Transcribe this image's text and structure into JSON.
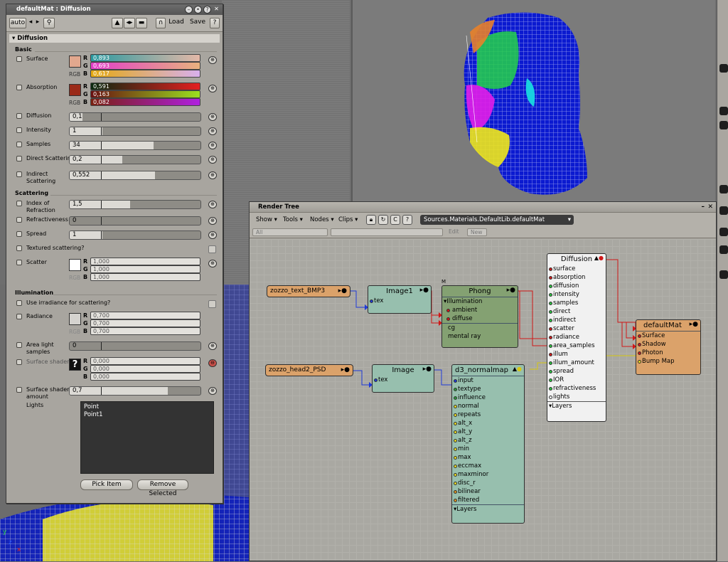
{
  "property_editor": {
    "title": "defaultMat : Diffusion",
    "toolbar": {
      "auto": "auto",
      "load": "Load",
      "save": "Save",
      "help": "?"
    },
    "section": "Diffusion",
    "groups": {
      "basic": "Basic",
      "scattering": "Scattering",
      "illumination": "Illumination"
    },
    "surface": {
      "label": "Surface",
      "color": "#e2a88e",
      "r": "0,893",
      "g": "0,693",
      "b": "0,617"
    },
    "absorption": {
      "label": "Absorption",
      "color": "#9b2a18",
      "r": "0,591",
      "g": "0,163",
      "b": "0,082"
    },
    "diffusion": {
      "label": "Diffusion",
      "value": "0,1",
      "fill": 0.1
    },
    "intensity": {
      "label": "Intensity",
      "value": "1",
      "fill": 0.25
    },
    "samples": {
      "label": "Samples",
      "value": "34",
      "fill": 0.64
    },
    "direct": {
      "label": "Direct Scattering",
      "value": "0,2",
      "fill": 0.4
    },
    "indirect": {
      "label": "Indirect Scattering",
      "value": "0,552",
      "fill": 0.65
    },
    "ior": {
      "label": "Index of Refraction",
      "value": "1,5",
      "fill": 0.46
    },
    "refractiveness": {
      "label": "Refractiveness",
      "value": "0",
      "fill": 0.0
    },
    "spread": {
      "label": "Spread",
      "value": "1",
      "fill": 0.25
    },
    "textured_scattering": {
      "label": "Textured scattering?"
    },
    "scatter": {
      "label": "Scatter",
      "color": "#ffffff",
      "r": "1,000",
      "g": "1,000",
      "b": "1,000"
    },
    "use_irradiance": {
      "label": "Use irradiance for scattering?"
    },
    "radiance": {
      "label": "Radiance",
      "color": "#d5d3cf",
      "r": "0,700",
      "g": "0,700",
      "b": "0,700"
    },
    "area_light": {
      "label": "Area light samples",
      "value": "0",
      "fill": 0.0
    },
    "surface_shader": {
      "label": "Surface shader",
      "r": "0,000",
      "g": "0,000",
      "b": "0,000"
    },
    "surface_shader_amount": {
      "label": "Surface shader amount",
      "value": "0,7",
      "fill": 0.75
    },
    "lights": {
      "label": "Lights",
      "items": [
        "Point",
        "Point1"
      ]
    },
    "buttons": {
      "pick": "Pick Item",
      "remove": "Remove Selected"
    },
    "rgb": "RGB",
    "channels": {
      "r": "R",
      "g": "G",
      "b": "B"
    }
  },
  "render_tree": {
    "title": "Render Tree",
    "menus": {
      "show": "Show",
      "tools": "Tools",
      "nodes": "Nodes",
      "clips": "Clips"
    },
    "path": "Sources.Materials.DefaultLib.defaultMat",
    "filter": "All",
    "edit": "Edit",
    "new": "New",
    "nodes": {
      "tex1": "zozzo_text_BMP3",
      "tex2": "zozzo_head2_PSD",
      "image1": "Image1",
      "image": "Image",
      "phong": "Phong",
      "phong_marker": "M",
      "phong_ports": [
        "Illumination",
        "ambient",
        "diffuse"
      ],
      "phong_extra": [
        "cg",
        "mental ray"
      ],
      "normalmap": "d3_normalmap",
      "normalmap_ports": [
        "input",
        "textype",
        "influence",
        "normal",
        "repeats",
        "alt_x",
        "alt_y",
        "alt_z",
        "min",
        "max",
        "eccmax",
        "maxminor",
        "disc_r",
        "bilinear",
        "filtered"
      ],
      "normalmap_layers": "Layers",
      "diffusion": "Diffusion",
      "diffusion_ports": [
        "surface",
        "absorption",
        "diffusion",
        "intensity",
        "samples",
        "direct",
        "indirect",
        "scatter",
        "radiance",
        "area_samples",
        "illum",
        "illum_amount",
        "spread",
        "IOR",
        "refractiveness",
        "lights"
      ],
      "diffusion_layers": "Layers",
      "defaultmat": "defaultMat",
      "defaultmat_ports": [
        "Surface",
        "Shadow",
        "Photon",
        "Bump Map"
      ],
      "tex_port": "tex"
    }
  }
}
